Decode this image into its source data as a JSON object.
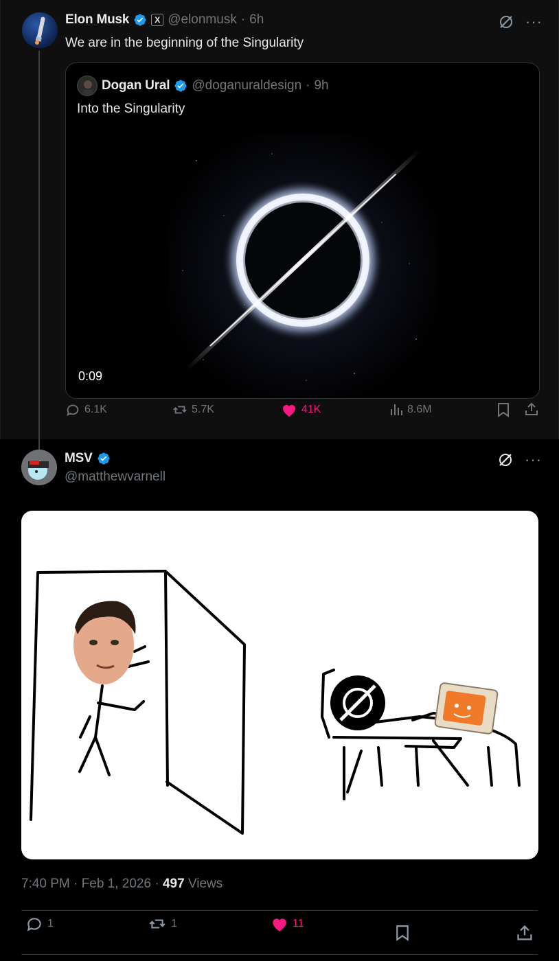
{
  "parent": {
    "name": "Elon Musk",
    "affiliate_glyph": "X",
    "handle": "@elonmusk",
    "time": "6h",
    "text": "We are in the beginning of the Singularity",
    "quote": {
      "name": "Dogan Ural",
      "handle": "@doganuraldesign",
      "time": "9h",
      "text": "Into the Singularity",
      "video_time": "0:09"
    },
    "stats": {
      "replies": "6.1K",
      "reposts": "5.7K",
      "likes": "41K",
      "views": "8.6M"
    }
  },
  "reply": {
    "name": "MSV",
    "handle": "@matthewvarnell",
    "date": "7:40 PM · Feb 1, 2026",
    "views_count": "497",
    "views_label": "Views",
    "stats": {
      "replies": "1",
      "reposts": "1",
      "likes": "11"
    }
  },
  "colors": {
    "accent_verified": "#1d9bf0",
    "like": "#f91880",
    "muted": "#71767b"
  },
  "icons": [
    "verified-icon",
    "grok-icon",
    "more-icon",
    "reply-icon",
    "repost-icon",
    "heart-icon",
    "views-icon",
    "bookmark-icon",
    "share-icon"
  ]
}
